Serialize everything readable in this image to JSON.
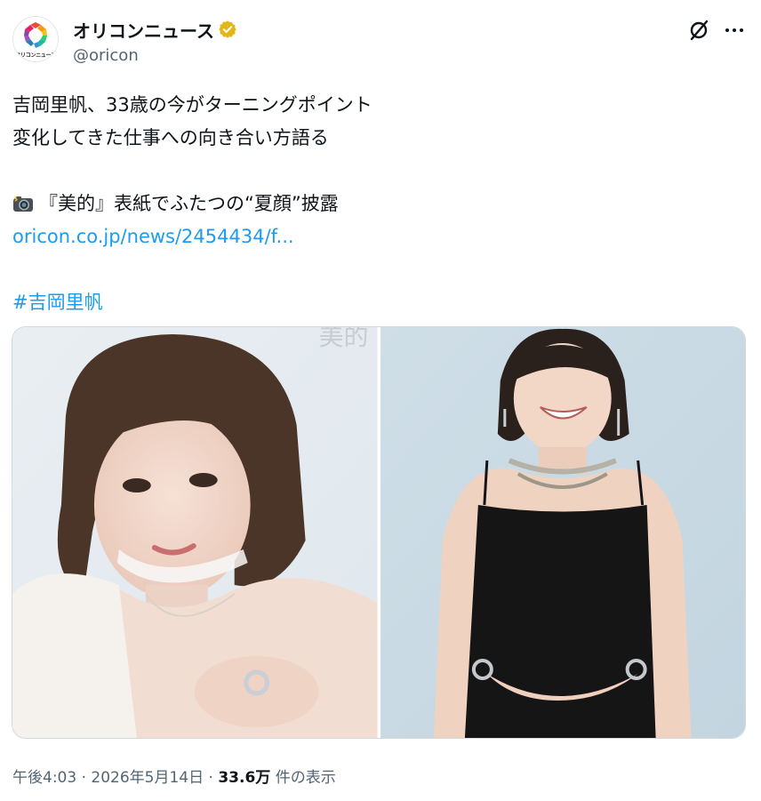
{
  "account": {
    "display_name": "オリコンニュース",
    "handle": "@oricon",
    "avatar_label": "オリコンニュース",
    "verified_color": "#e2b719"
  },
  "tweet": {
    "line1": "吉岡里帆、33歳の今がターニングポイント",
    "line2": "変化してきた仕事への向き合い方語る",
    "line3": "『美的』表紙でふたつの“夏顔”披露",
    "link": "oricon.co.jp/news/2454434/f...",
    "hashtag": "#吉岡里帆"
  },
  "media": {
    "photo_left_alt": "portrait-left",
    "photo_right_alt": "portrait-right",
    "watermark": "美的"
  },
  "meta": {
    "time": "午後4:03",
    "sep1": " · ",
    "date": "2026年5月14日",
    "sep2": " · ",
    "views": "33.6万",
    "views_suffix": " 件の表示"
  },
  "colors": {
    "link": "#1d9bf0",
    "text": "#0f1419",
    "secondary": "#536471"
  },
  "icons": [
    "grok-icon",
    "more-icon",
    "verified-badge-icon",
    "camera-emoji-icon"
  ]
}
